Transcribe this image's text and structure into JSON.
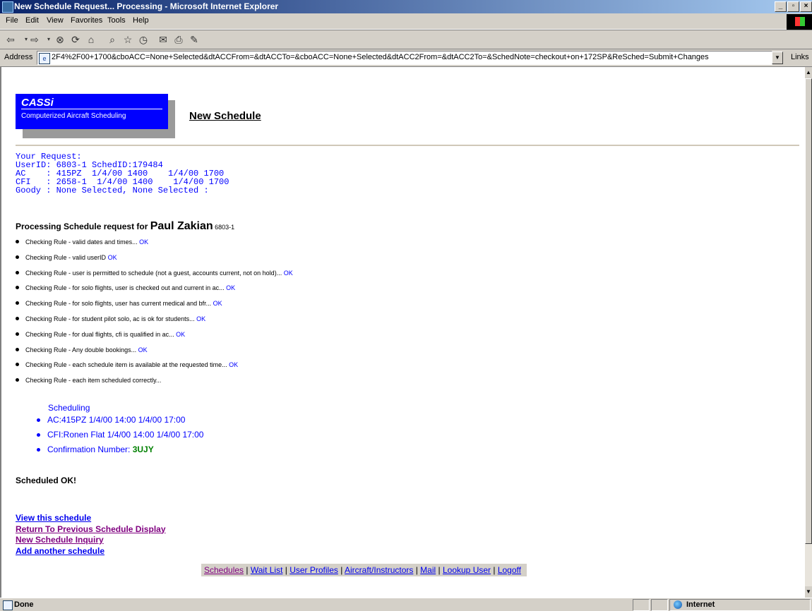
{
  "window": {
    "title": "New Schedule Request... Processing - Microsoft Internet Explorer"
  },
  "menu": [
    "File",
    "Edit",
    "View",
    "Favorites",
    "Tools",
    "Help"
  ],
  "address": {
    "label": "Address",
    "url": "2F4%2F00+1700&cboACC=None+Selected&dtACCFrom=&dtACCTo=&cboACC=None+Selected&dtACC2From=&dtACC2To=&SchedNote=checkout+on+172SP&ReSched=Submit+Changes",
    "links_label": "Links"
  },
  "logo": {
    "title": "CASSi",
    "subtitle": "Computerized Aircraft Scheduling"
  },
  "page_title": "New Schedule",
  "request": {
    "heading": "Your Request:",
    "user_line": "UserID: 6803-1 SchedID:179484",
    "ac_line": "AC    : 415PZ  1/4/00 1400    1/4/00 1700",
    "cfi_line": "CFI   : 2658-1  1/4/00 1400    1/4/00 1700",
    "goody_line": "Goody : None Selected, None Selected :"
  },
  "processing": {
    "prefix": "Processing Schedule request for ",
    "name": "Paul Zakian",
    "user_id": " 6803-1"
  },
  "rules": [
    {
      "text": "Checking Rule - valid dates and times... ",
      "result": "OK"
    },
    {
      "text": "Checking Rule - valid userID ",
      "result": "OK"
    },
    {
      "text": "Checking Rule - user is permitted to schedule (not a guest, accounts current, not on hold)... ",
      "result": "OK"
    },
    {
      "text": "Checking Rule - for solo flights, user is checked out and current in ac... ",
      "result": "OK"
    },
    {
      "text": "Checking Rule - for solo flights, user has current medical and bfr... ",
      "result": "OK"
    },
    {
      "text": "Checking Rule - for student pilot solo, ac is ok for students... ",
      "result": "OK"
    },
    {
      "text": "Checking Rule - for dual flights, cfi is qualified in ac... ",
      "result": "OK"
    },
    {
      "text": "Checking Rule - Any double bookings... ",
      "result": "OK"
    },
    {
      "text": "Checking Rule - each schedule item is available at the requested time... ",
      "result": "OK"
    },
    {
      "text": "Checking Rule - each item scheduled correctly...",
      "result": ""
    }
  ],
  "scheduling": {
    "heading": "Scheduling",
    "items": [
      "AC:415PZ 1/4/00 14:00 1/4/00 17:00",
      "CFI:Ronen Flat 1/4/00 14:00 1/4/00 17:00"
    ],
    "confirmation_label": "Confirmation Number: ",
    "confirmation_number": "3UJY"
  },
  "result": "Scheduled OK!",
  "links": {
    "view": "View this schedule",
    "return": "Return To Previous Schedule Display",
    "new_inquiry": "New Schedule Inquiry",
    "add_another": "Add another schedule"
  },
  "nav": {
    "schedules": "Schedules",
    "wait_list": "Wait List",
    "user_profiles": "User Profiles",
    "aircraft_instructors": "Aircraft/Instructors",
    "mail": "Mail",
    "lookup_user": "Lookup User",
    "logoff": "Logoff",
    "separator": " | "
  },
  "status": {
    "text": "Done",
    "zone": "Internet"
  },
  "colors": {
    "title_bar": "#0a246a",
    "logo_bg": "#0000ff",
    "link": "#0000ee",
    "visited": "#800080",
    "ok": "#0000ff",
    "confirmation": "#008000"
  }
}
